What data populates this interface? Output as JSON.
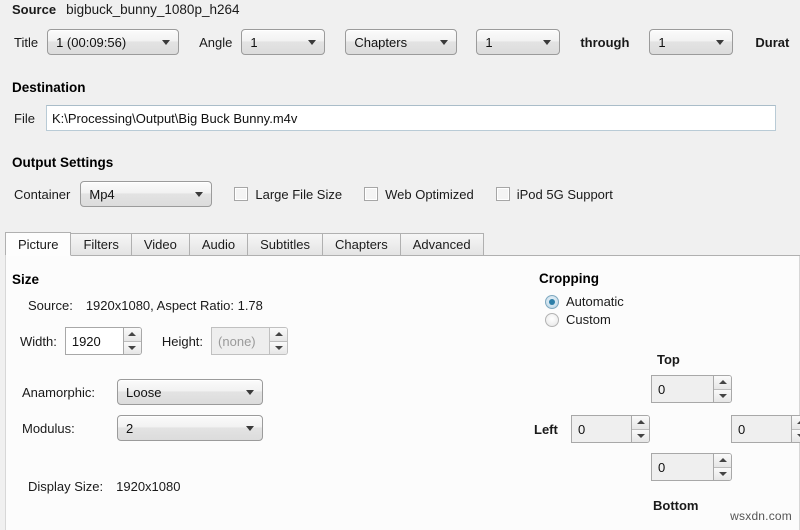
{
  "source": {
    "label": "Source",
    "value": "bigbuck_bunny_1080p_h264"
  },
  "title_row": {
    "title_label": "Title",
    "title_value": "1 (00:09:56)",
    "angle_label": "Angle",
    "angle_value": "1",
    "range_type_value": "Chapters",
    "chapter_start_value": "1",
    "through_label": "through",
    "chapter_end_value": "1",
    "duration_label": "Durat"
  },
  "destination": {
    "heading": "Destination",
    "file_label": "File",
    "file_value": "K:\\Processing\\Output\\Big Buck Bunny.m4v"
  },
  "output_settings": {
    "heading": "Output Settings",
    "container_label": "Container",
    "container_value": "Mp4",
    "large_file_size_label": "Large File Size",
    "web_optimized_label": "Web Optimized",
    "ipod_support_label": "iPod 5G Support"
  },
  "tabs": [
    {
      "label": "Picture",
      "active": true
    },
    {
      "label": "Filters",
      "active": false
    },
    {
      "label": "Video",
      "active": false
    },
    {
      "label": "Audio",
      "active": false
    },
    {
      "label": "Subtitles",
      "active": false
    },
    {
      "label": "Chapters",
      "active": false
    },
    {
      "label": "Advanced",
      "active": false
    }
  ],
  "picture": {
    "size_heading": "Size",
    "source_key": "Source:",
    "source_value": "1920x1080, Aspect Ratio: 1.78",
    "width_label": "Width:",
    "width_value": "1920",
    "height_label": "Height:",
    "height_placeholder": "(none)",
    "anamorphic_label": "Anamorphic:",
    "anamorphic_value": "Loose",
    "modulus_label": "Modulus:",
    "modulus_value": "2",
    "display_size_key": "Display Size:",
    "display_size_value": "1920x1080"
  },
  "cropping": {
    "heading": "Cropping",
    "automatic_label": "Automatic",
    "custom_label": "Custom",
    "selected": "Automatic",
    "top_label": "Top",
    "top_value": "0",
    "left_label": "Left",
    "left_value": "0",
    "right_value": "0",
    "bottom_label": "Bottom",
    "bottom_value": "0"
  },
  "watermark": {
    "text": "wsxdn.com"
  },
  "colors": {
    "window_background": "#f0f0f0",
    "tab_panel": "#fcfcfc",
    "accent_radio": "#2d7fa8",
    "text": "#1a1a1a"
  }
}
